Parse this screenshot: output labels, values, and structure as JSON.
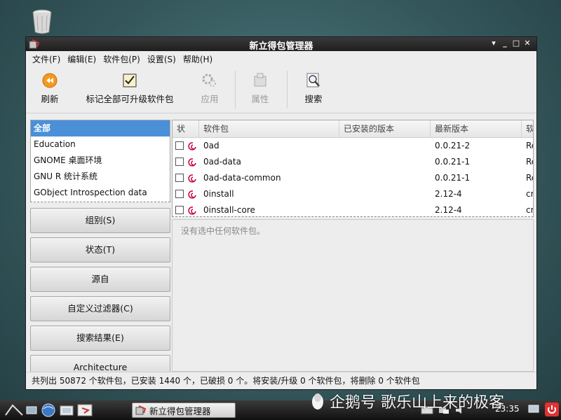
{
  "window": {
    "title": "新立得包管理器"
  },
  "menu": [
    "文件(F)",
    "编辑(E)",
    "软件包(P)",
    "设置(S)",
    "帮助(H)"
  ],
  "toolbar": {
    "refresh": "刷新",
    "mark_all_upgrades": "标记全部可升级软件包",
    "apply": "应用",
    "properties": "属性",
    "search": "搜索"
  },
  "categories": [
    "全部",
    "Education",
    "GNOME 桌面环境",
    "GNU R 统计系统",
    "GObject Introspection data"
  ],
  "filter_buttons": [
    "组别(S)",
    "状态(T)",
    "源自",
    "自定义过滤器(C)",
    "搜索结果(E)",
    "Architecture"
  ],
  "table": {
    "columns": [
      "状",
      "软件包",
      "已安装的版本",
      "最新版本",
      "软"
    ],
    "rows": [
      {
        "name": "0ad",
        "installed": "",
        "latest": "0.0.21-2",
        "extra": "Re"
      },
      {
        "name": "0ad-data",
        "installed": "",
        "latest": "0.0.21-1",
        "extra": "Re"
      },
      {
        "name": "0ad-data-common",
        "installed": "",
        "latest": "0.0.21-1",
        "extra": "Re"
      },
      {
        "name": "0install",
        "installed": "",
        "latest": "2.12-4",
        "extra": "cr"
      },
      {
        "name": "0install-core",
        "installed": "",
        "latest": "2.12-4",
        "extra": "cr"
      }
    ]
  },
  "details": {
    "empty_text": "没有选中任何软件包。"
  },
  "status_bar": "共列出 50872 个软件包，已安装 1440 个，已破损 0 个。将安装/升级 0 个软件包，将删除 0 个软件包",
  "taskbar": {
    "task_label": "新立得包管理器",
    "clock": "23:35"
  },
  "watermark": "企鹅号 歌乐山上来的极客",
  "colors": {
    "selection": "#4a90d9",
    "titlebar": "#2a2a2a",
    "desktop": "#3f676c",
    "debian_swirl": "#c70036"
  }
}
